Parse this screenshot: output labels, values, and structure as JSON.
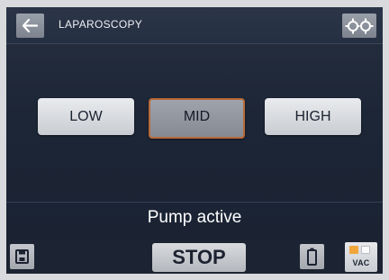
{
  "header": {
    "title": "LAPAROSCOPY",
    "back_icon": "arrow-left-icon",
    "settings_icon": "settings-gears-icon"
  },
  "modes": {
    "items": [
      {
        "label": "LOW",
        "selected": false
      },
      {
        "label": "MID",
        "selected": true
      },
      {
        "label": "HIGH",
        "selected": false
      }
    ]
  },
  "status": {
    "text": "Pump active"
  },
  "footer": {
    "save_icon": "save-icon",
    "stop_label": "STOP",
    "battery_icon": "battery-icon",
    "vac_label": "VAC"
  },
  "colors": {
    "screen_bg": "#1d2636",
    "selected_border": "#b86a3a",
    "vac_indicator_on": "#f0a63a"
  }
}
